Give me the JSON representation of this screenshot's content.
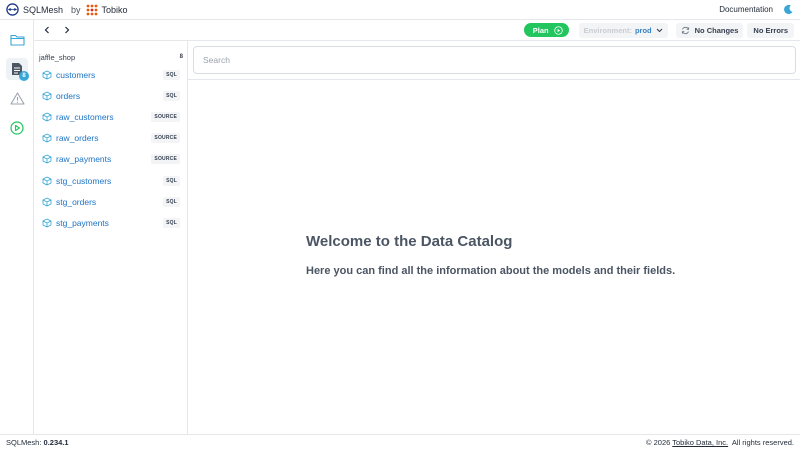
{
  "header": {
    "app_name": "SQLMesh",
    "by_text": "by",
    "company_name": "Tobiko",
    "documentation_label": "Documentation",
    "theme_icon": "moon-icon"
  },
  "rail": {
    "items": [
      {
        "icon": "folder-icon",
        "active": false
      },
      {
        "icon": "document-icon",
        "active": true,
        "badge": "8"
      },
      {
        "icon": "warning-icon",
        "active": false
      },
      {
        "icon": "play-circle-icon",
        "active": false
      }
    ]
  },
  "toolbar": {
    "back_icon": "chevron-left-icon",
    "forward_icon": "chevron-right-icon",
    "plan_label": "Plan",
    "environment_label": "Environment:",
    "environment_value": "prod",
    "changes_label": "No Changes",
    "errors_label": "No Errors"
  },
  "sidebar": {
    "group_name": "jaffle_shop",
    "group_count": "8",
    "models": [
      {
        "name": "customers",
        "kind": "SQL"
      },
      {
        "name": "orders",
        "kind": "SQL"
      },
      {
        "name": "raw_customers",
        "kind": "SOURCE"
      },
      {
        "name": "raw_orders",
        "kind": "SOURCE"
      },
      {
        "name": "raw_payments",
        "kind": "SOURCE"
      },
      {
        "name": "stg_customers",
        "kind": "SQL"
      },
      {
        "name": "stg_orders",
        "kind": "SQL"
      },
      {
        "name": "stg_payments",
        "kind": "SQL"
      }
    ]
  },
  "main": {
    "search_placeholder": "Search",
    "welcome_title": "Welcome to the Data Catalog",
    "welcome_subtitle": "Here you can find all the information about the models and their fields."
  },
  "footer": {
    "version_label": "SQLMesh:",
    "version": "0.234.1",
    "copyright_prefix": "© 2026",
    "company_link": "Tobiko Data, Inc.",
    "rights": "All rights reserved."
  },
  "colors": {
    "accent_blue": "#1d73c4",
    "plan_green": "#22c55e",
    "badge_blue": "#38a6d6"
  }
}
